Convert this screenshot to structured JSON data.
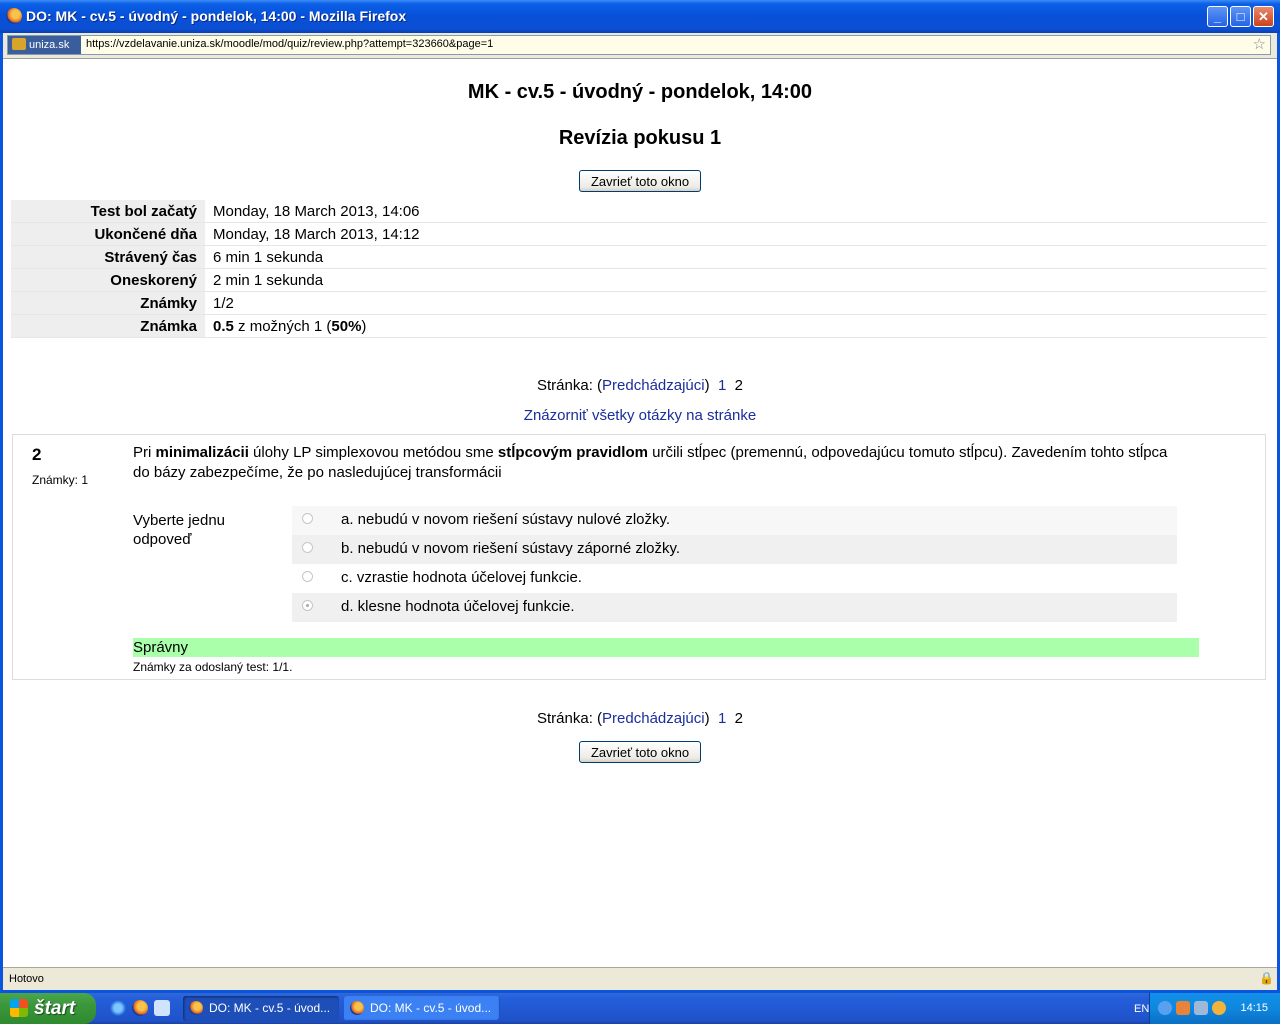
{
  "window": {
    "title": "DO: MK - cv.5 - úvodný - pondelok, 14:00 - Mozilla Firefox",
    "controls": {
      "minimize": "_",
      "maximize": "□",
      "close": "✕"
    }
  },
  "addressbar": {
    "site_identity": "uniza.sk",
    "url": "https://vzdelavanie.uniza.sk/moodle/mod/quiz/review.php?attempt=323660&page=1"
  },
  "page": {
    "course_title": "MK - cv.5 - úvodný - pondelok, 14:00",
    "review_title": "Revízia pokusu 1",
    "close_button": "Zavrieť toto okno"
  },
  "summary": [
    {
      "label": "Test bol začatý",
      "value": "Monday, 18 March 2013, 14:06"
    },
    {
      "label": "Ukončené dňa",
      "value": "Monday, 18 March 2013, 14:12"
    },
    {
      "label": "Strávený čas",
      "value": "6 min 1 sekunda"
    },
    {
      "label": "Oneskorený",
      "value": "2 min 1 sekunda"
    },
    {
      "label": "Známky",
      "value": "1/2"
    },
    {
      "label": "Známka",
      "value_bold": "0.5",
      "value_mid": " z možných 1 (",
      "value_bold2": "50%",
      "value_end": ")"
    }
  ],
  "pager": {
    "label": "Stránka:",
    "prev_open": "(",
    "prev": "Predchádzajúci",
    "prev_close": ")",
    "page1": "1",
    "page2": "2",
    "show_all": "Znázorniť všetky otázky na stránke"
  },
  "question": {
    "number": "2",
    "grade": "Známky: 1",
    "text_parts": [
      {
        "t": "Pri ",
        "b": false
      },
      {
        "t": "minimalizácii",
        "b": true
      },
      {
        "t": " úlohy LP simplexovou metódou sme ",
        "b": false
      },
      {
        "t": "stĺpcovým pravidlom",
        "b": true
      },
      {
        "t": " určili stĺpec (premennú, odpovedajúcu tomuto stĺpcu). Zavedením tohto stĺpca do bázy zabezpečíme, že po nasledujúcej transformácii",
        "b": false
      }
    ],
    "prompt": "Vyberte jednu odpoveď",
    "answers": [
      {
        "text": "a. nebudú v novom riešení sústavy nulové zložky.",
        "checked": false
      },
      {
        "text": "b. nebudú v novom riešení sústavy záporné zložky.",
        "checked": false
      },
      {
        "text": "c. vzrastie hodnota účelovej funkcie.",
        "checked": false
      },
      {
        "text": "d. klesne hodnota účelovej funkcie.",
        "checked": true
      }
    ],
    "outcome": "Správny",
    "outcome_color": "#aaffaa",
    "submitted_grade": "Známky za odoslaný test: 1/1."
  },
  "statusbar": {
    "text": "Hotovo",
    "lock_icon": "lock-icon"
  },
  "taskbar": {
    "start": "štart",
    "tasks": [
      "DO: MK - cv.5 - úvod...",
      "DO: MK - cv.5 - úvod..."
    ],
    "language": "EN",
    "clock": "14:15"
  }
}
